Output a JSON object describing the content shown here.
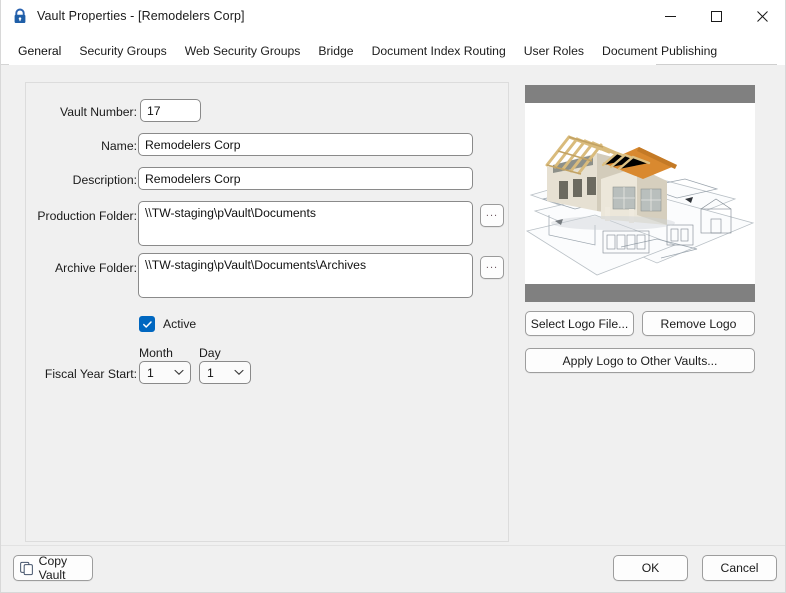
{
  "window": {
    "title": "Vault Properties - [Remodelers Corp]",
    "icon": "lock-icon",
    "controls": {
      "minimize": "minimize-icon",
      "maximize": "maximize-icon",
      "close": "close-icon"
    }
  },
  "tabs": [
    {
      "label": "General",
      "active": true
    },
    {
      "label": "Security Groups",
      "active": false
    },
    {
      "label": "Web Security Groups",
      "active": false
    },
    {
      "label": "Bridge",
      "active": false
    },
    {
      "label": "Document Index Routing",
      "active": false
    },
    {
      "label": "User Roles",
      "active": false
    },
    {
      "label": "Document Publishing",
      "active": false
    }
  ],
  "form": {
    "vault_number": {
      "label": "Vault Number:",
      "value": "17"
    },
    "name": {
      "label": "Name:",
      "value": "Remodelers Corp"
    },
    "description": {
      "label": "Description:",
      "value": "Remodelers Corp"
    },
    "production_folder": {
      "label": "Production Folder:",
      "value": "\\\\TW-staging\\pVault\\Documents",
      "browse_label": "..."
    },
    "archive_folder": {
      "label": "Archive Folder:",
      "value": "\\\\TW-staging\\pVault\\Documents\\Archives",
      "browse_label": "..."
    },
    "active": {
      "label": "Active",
      "checked": true
    },
    "fiscal_year_start": {
      "label": "Fiscal Year Start:",
      "month_label": "Month",
      "month_value": "1",
      "day_label": "Day",
      "day_value": "1"
    }
  },
  "logo_panel": {
    "image_alt": "house-model-on-blueprints-photo",
    "select_logo": "Select Logo File...",
    "remove_logo": "Remove Logo",
    "apply_logo": "Apply Logo to Other Vaults..."
  },
  "footer": {
    "copy_vault": "Copy Vault",
    "copy_vault_icon": "copy-icon",
    "ok": "OK",
    "cancel": "Cancel"
  },
  "colors": {
    "accent": "#0067c0",
    "window_bg": "#f0f0f0",
    "titlebar_bg": "#ffffff",
    "logo_frame": "#808080",
    "roof": "#d98b35",
    "wood": "#d8b878"
  }
}
